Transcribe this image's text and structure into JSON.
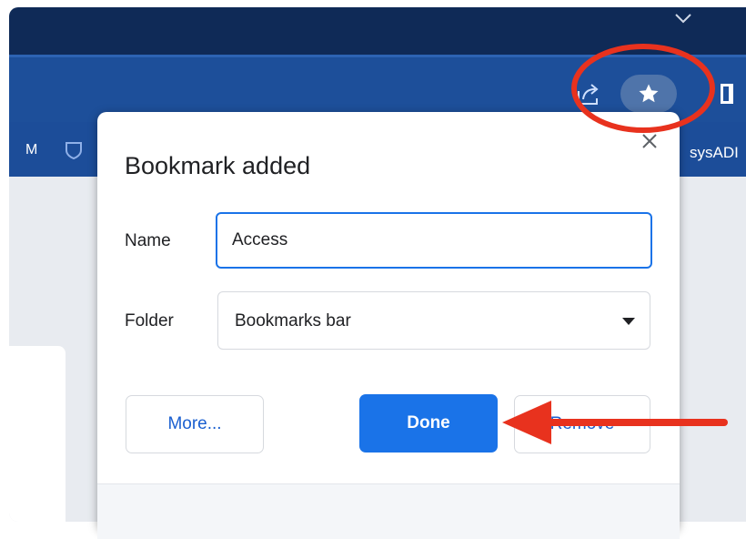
{
  "browser": {
    "bookmarks_bar_left_text": "M",
    "bookmarks_bar_right_text": "sysADI"
  },
  "dialog": {
    "title": "Bookmark added",
    "name_label": "Name",
    "name_value": "Access",
    "folder_label": "Folder",
    "folder_value": "Bookmarks bar",
    "more_label": "More...",
    "done_label": "Done",
    "remove_label": "Remove"
  },
  "icons": {
    "share": "share-icon",
    "star": "star-icon",
    "close": "close-icon",
    "dropdown": "chevron-down-icon",
    "side_panel": "side-panel-icon"
  },
  "colors": {
    "titlebar": "#0f2a57",
    "toolbar": "#1d4f9a",
    "accent": "#1a73e8",
    "annotation": "#e8321e"
  }
}
